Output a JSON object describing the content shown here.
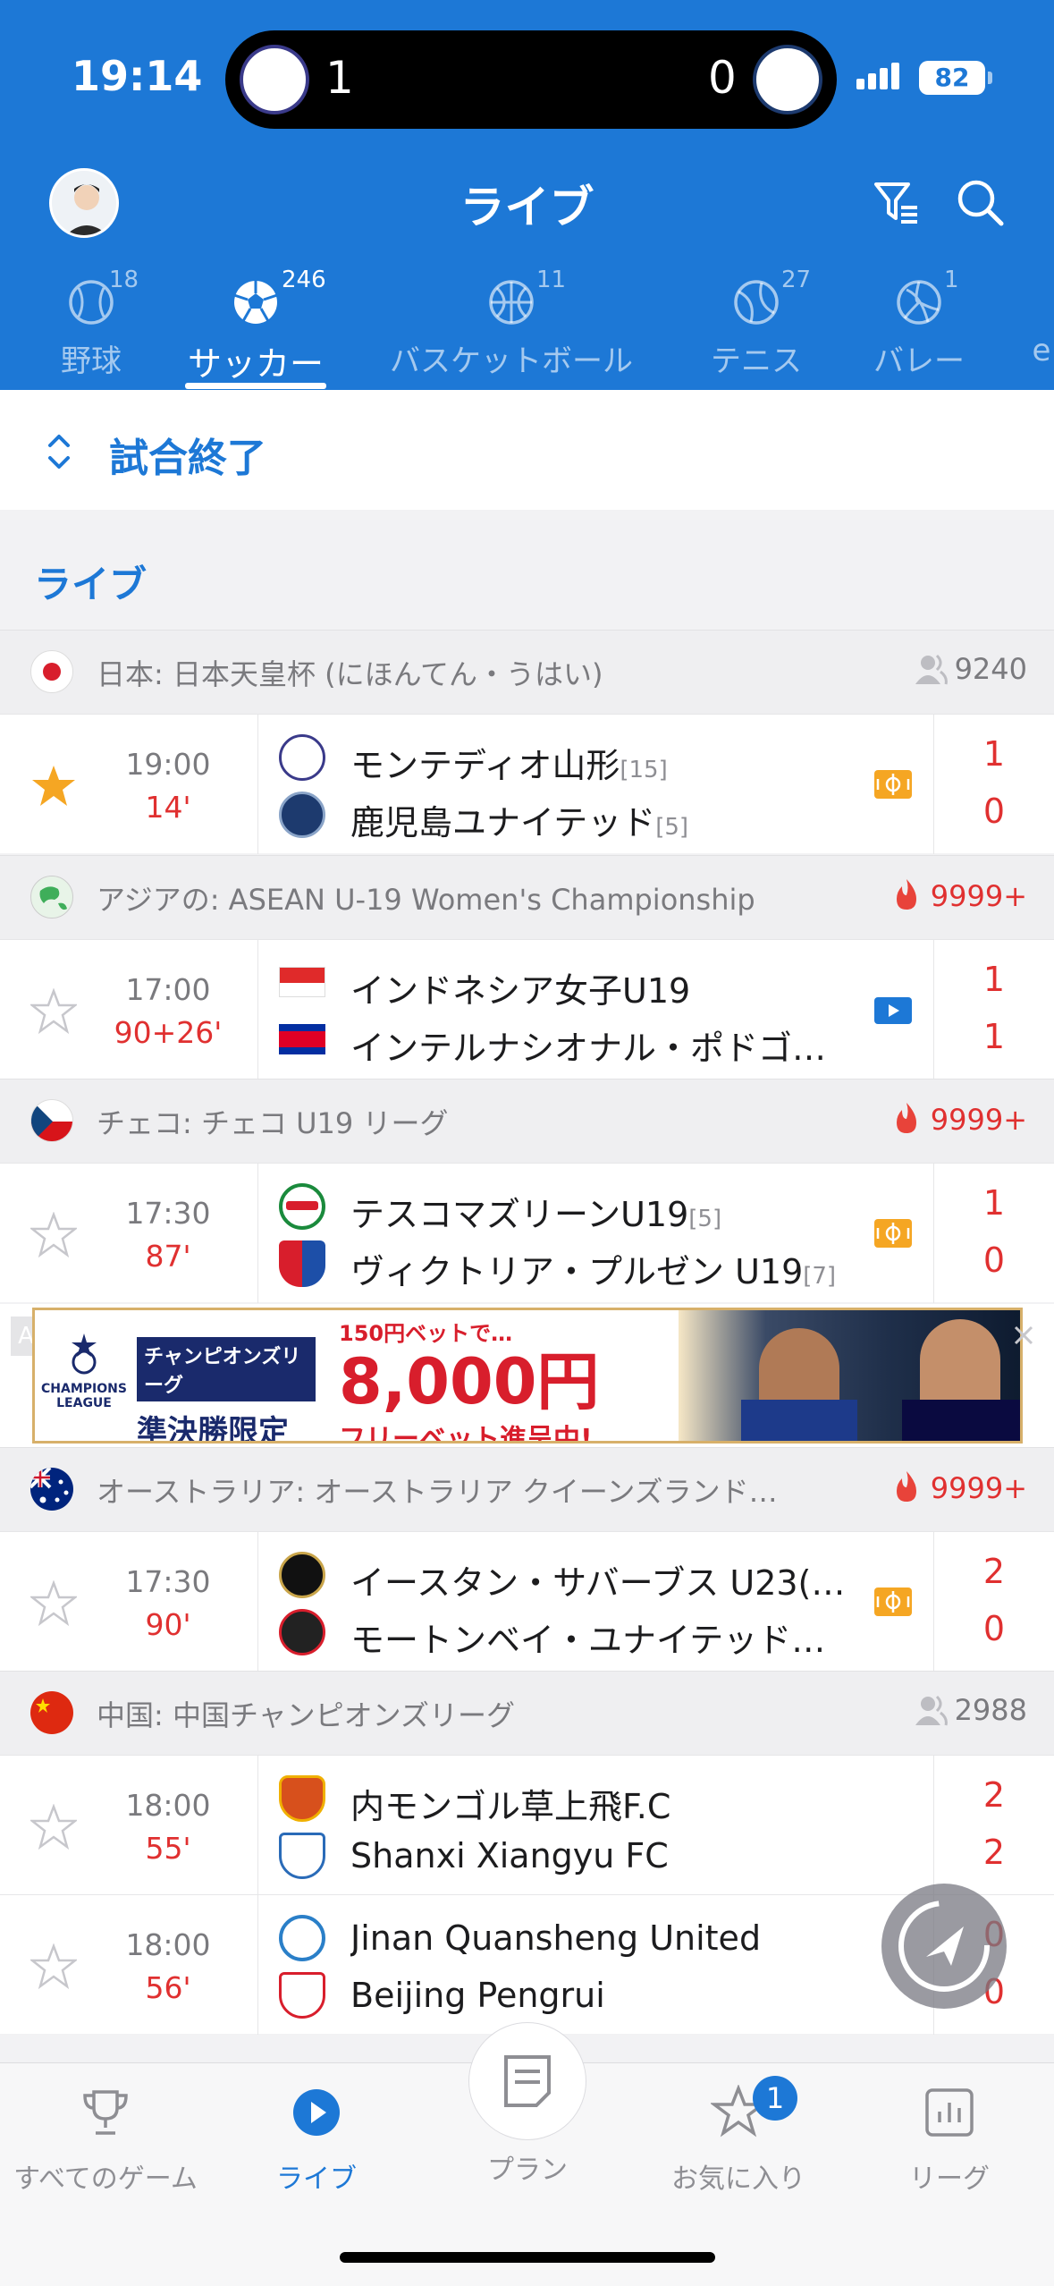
{
  "status_bar": {
    "time": "19:14",
    "battery": "82"
  },
  "live_activity": {
    "home_score": "1",
    "away_score": "0"
  },
  "header": {
    "title": "ライブ"
  },
  "sport_tabs": [
    {
      "label": "野球",
      "count": "18"
    },
    {
      "label": "サッカー",
      "count": "246"
    },
    {
      "label": "バスケットボール",
      "count": "11"
    },
    {
      "label": "テニス",
      "count": "27"
    },
    {
      "label": "バレー",
      "count": "1"
    },
    {
      "label": "e",
      "count": ""
    }
  ],
  "finished_toggle": {
    "label": "試合終了"
  },
  "section": {
    "title": "ライブ"
  },
  "leagues": [
    {
      "name": "日本: 日本天皇杯 (にほんてん・うはい)",
      "stat": "9240",
      "stat_type": "view",
      "flag": "japan-flag-icon",
      "matches": [
        {
          "kickoff": "19:00",
          "minute": "14'",
          "starred": true,
          "media": "live-graph-icon",
          "home": {
            "name": "モンテディオ山形",
            "rank": "[15]",
            "score": "1"
          },
          "away": {
            "name": "鹿児島ユナイテッド",
            "rank": "[5]",
            "score": "0"
          }
        }
      ]
    },
    {
      "name": "アジアの: ASEAN U-19 Women's Championship",
      "stat": "9999+",
      "stat_type": "hot",
      "flag": "asia-globe-icon",
      "matches": [
        {
          "kickoff": "17:00",
          "minute": "90+26'",
          "starred": false,
          "media": "video-icon",
          "home": {
            "name": "インドネシア女子U19",
            "rank": "",
            "score": "1"
          },
          "away": {
            "name": "インテルナシオナル・ポドゴ…",
            "rank": "",
            "score": "1"
          }
        }
      ]
    },
    {
      "name": "チェコ: チェコ U19 リーグ",
      "stat": "9999+",
      "stat_type": "hot",
      "flag": "czech-flag-icon",
      "matches": [
        {
          "kickoff": "17:30",
          "minute": "87'",
          "starred": false,
          "media": "live-graph-icon",
          "home": {
            "name": "テスコマズリーンU19",
            "rank": "[5]",
            "score": "1"
          },
          "away": {
            "name": "ヴィクトリア・プルゼン U19",
            "rank": "[7]",
            "score": "0"
          }
        }
      ]
    },
    {
      "name": "オーストラリア: オーストラリア クイーンズランド…",
      "stat": "9999+",
      "stat_type": "hot",
      "flag": "australia-flag-icon",
      "matches": [
        {
          "kickoff": "17:30",
          "minute": "90'",
          "starred": false,
          "media": "live-graph-icon",
          "home": {
            "name": "イースタン・サバーブス U23(…",
            "rank": "",
            "score": "2"
          },
          "away": {
            "name": "モートンベイ・ユナイテッド…",
            "rank": "",
            "score": "0"
          }
        }
      ]
    },
    {
      "name": "中国: 中国チャンピオンズリーグ",
      "stat": "2988",
      "stat_type": "view",
      "flag": "china-flag-icon",
      "matches": [
        {
          "kickoff": "18:00",
          "minute": "55'",
          "starred": false,
          "media": "",
          "home": {
            "name": "内モンゴル草上飛F.C",
            "rank": "",
            "score": "2"
          },
          "away": {
            "name": "Shanxi Xiangyu FC",
            "rank": "",
            "score": "2"
          }
        },
        {
          "kickoff": "18:00",
          "minute": "56'",
          "starred": false,
          "media": "",
          "home": {
            "name": "Jinan Quansheng United",
            "rank": "",
            "score": "0"
          },
          "away": {
            "name": "Beijing Pengrui",
            "rank": "",
            "score": "0"
          }
        }
      ]
    }
  ],
  "ad": {
    "tag": "AD",
    "league_line1": "CHAMPIONS",
    "league_line2": "LEAGUE",
    "title_line1": "チャンピオンズリーグ",
    "title_line2": "準決勝限定",
    "promo_small": "150円ベットで…",
    "promo_amount": "8,000円",
    "promo_sub": "フリーベット進呈中!"
  },
  "bottom_tabs": [
    {
      "label": "すべてのゲーム",
      "icon": "trophy-icon"
    },
    {
      "label": "ライブ",
      "icon": "live-play-icon"
    },
    {
      "label": "プラン",
      "icon": "plan-icon"
    },
    {
      "label": "お気に入り",
      "icon": "favorites-star-icon",
      "badge": "1"
    },
    {
      "label": "リーグ",
      "icon": "league-chart-icon"
    }
  ],
  "colors": {
    "primary": "#1d78d6",
    "live_red": "#e03030",
    "star_gold": "#f5a623"
  }
}
